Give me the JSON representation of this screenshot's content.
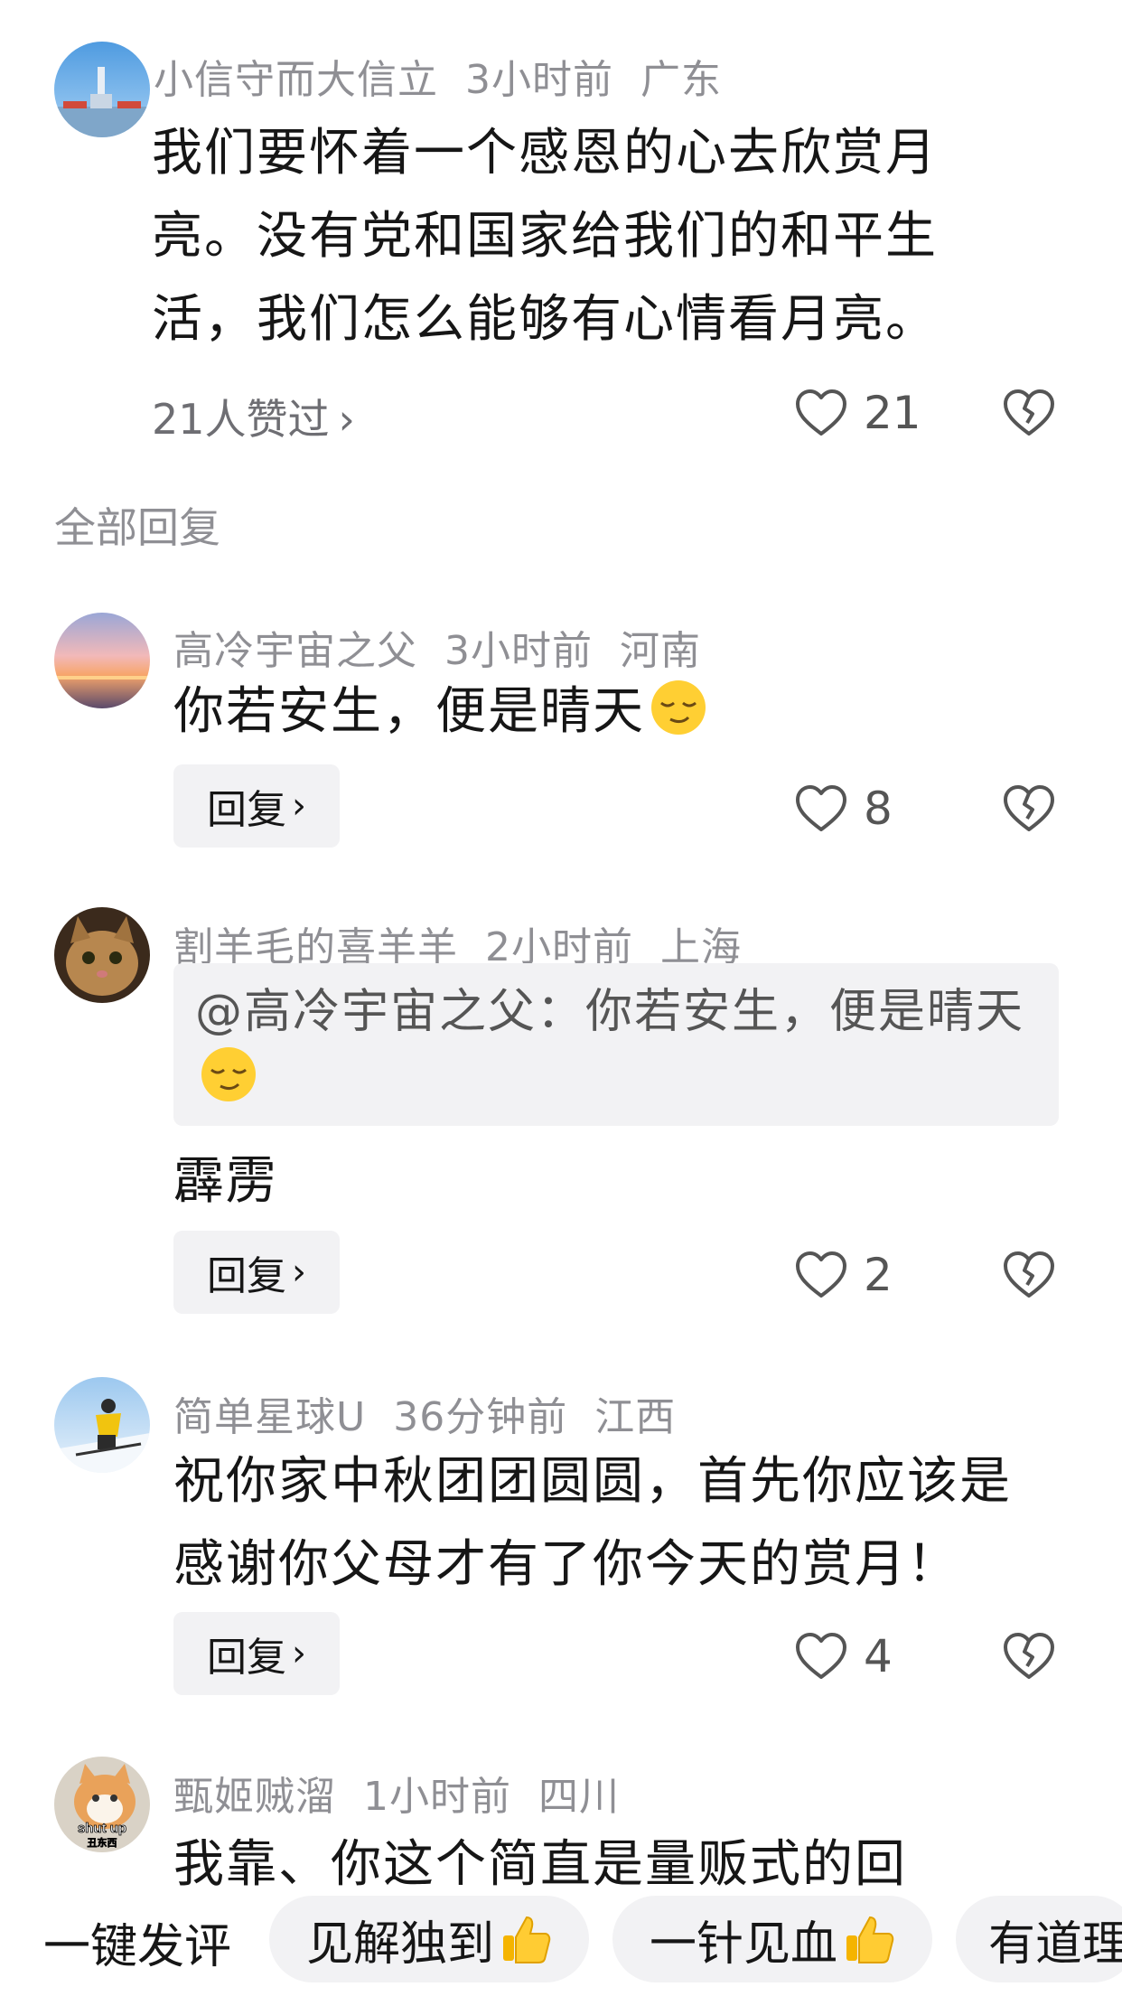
{
  "main_comment": {
    "username": "小信守而大信立",
    "time": "3小时前",
    "location": "广东",
    "text": "我们要怀着一个感恩的心去欣赏月亮。没有党和国家给我们的和平生活，我们怎么能够有心情看月亮。",
    "likers_label": "21人赞过",
    "like_count": "21"
  },
  "all_replies_label": "全部回复",
  "replies": [
    {
      "username": "高冷宇宙之父",
      "time": "3小时前",
      "location": "河南",
      "text": "你若安生，便是晴天",
      "reply_label": "回复",
      "like_count": "8"
    },
    {
      "username": "割羊毛的喜羊羊",
      "time": "2小时前",
      "location": "上海",
      "quote": "@高冷宇宙之父：你若安生，便是晴天",
      "text": "霹雳",
      "reply_label": "回复",
      "like_count": "2"
    },
    {
      "username": "简单星球U",
      "time": "36分钟前",
      "location": "江西",
      "text": "祝你家中秋团团圆圆，首先你应该是感谢你父母才有了你今天的赏月！",
      "reply_label": "回复",
      "like_count": "4"
    },
    {
      "username": "甄姬贼溜",
      "time": "1小时前",
      "location": "四川",
      "text": "我靠、你这个简直是量贩式的回",
      "avatar_caption_1": "shut up",
      "avatar_caption_2": "丑东西"
    }
  ],
  "quick_bar": {
    "label": "一键发评",
    "chips": [
      "见解独到",
      "一针见血",
      "有道理"
    ]
  },
  "icons": {
    "like": "heart-outline-icon",
    "dislike": "broken-heart-icon",
    "emoji": "smirk-emoji-icon",
    "thumb": "thumbs-up-emoji-icon"
  },
  "colors": {
    "meta": "#8f8f94",
    "chip_bg": "#f2f2f4",
    "text": "#161616"
  }
}
